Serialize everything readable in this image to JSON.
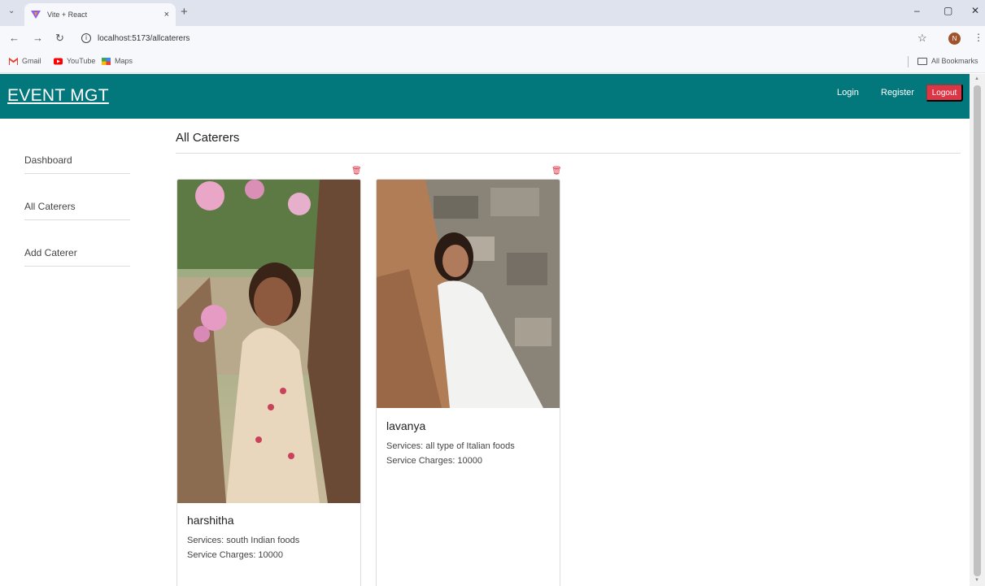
{
  "browser": {
    "tab_title": "Vite + React",
    "url": "localhost:5173/allcaterers",
    "profile_initial": "N",
    "bookmarks": [
      "Gmail",
      "YouTube",
      "Maps"
    ],
    "all_bookmarks": "All Bookmarks",
    "tab_close": "×",
    "new_tab": "+",
    "minimize": "–",
    "restore": "▢",
    "close": "✕"
  },
  "navbar": {
    "brand": "EVENT MGT",
    "login": "Login",
    "register": "Register",
    "logout": "Logout",
    "color": "#03787c",
    "logout_color": "#dc3545"
  },
  "sidebar": {
    "items": [
      {
        "label": "Dashboard"
      },
      {
        "label": "All Caterers"
      },
      {
        "label": "Add Caterer"
      }
    ]
  },
  "main": {
    "title": "All Caterers",
    "caterers": [
      {
        "name": "harshitha",
        "services": "Services: south Indian foods",
        "charges": "Service Charges: 10000"
      },
      {
        "name": "lavanya",
        "services": "Services: all type of Italian foods",
        "charges": "Service Charges: 10000"
      }
    ]
  },
  "icons": {
    "delete": "trash-icon",
    "star": "star-icon",
    "kebab": "kebab-menu-icon"
  }
}
